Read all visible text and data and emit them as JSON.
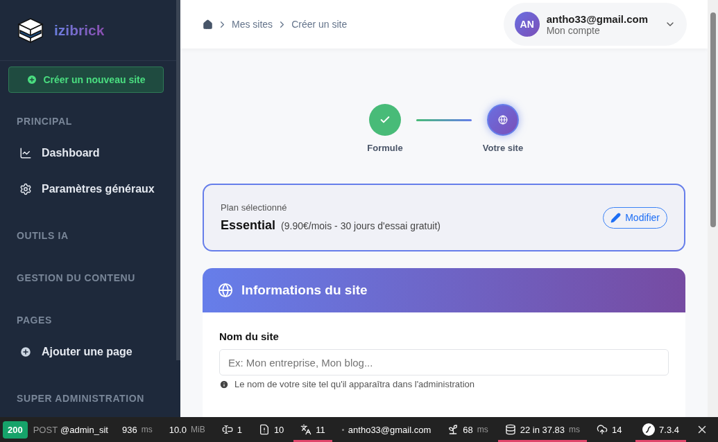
{
  "sidebar": {
    "brand": "izibrick",
    "create_button": "Créer un nouveau site",
    "sections": [
      {
        "title": "PRINCIPAL",
        "items": [
          {
            "label": "Dashboard",
            "kind": "chart"
          },
          {
            "label": "Paramètres généraux",
            "kind": "settings"
          }
        ]
      },
      {
        "title": "OUTILS IA"
      },
      {
        "title": "GESTION DU CONTENU"
      },
      {
        "title": "PAGES",
        "items": [
          {
            "label": "Ajouter une page",
            "kind": "add"
          }
        ]
      },
      {
        "title": "SUPER ADMINISTRATION"
      }
    ]
  },
  "breadcrumb": [
    "Mes sites",
    "Créer un site"
  ],
  "account": {
    "initials": "AN",
    "email": "antho33@gmail.com",
    "subtitle": "Mon compte"
  },
  "steps": [
    {
      "label": "Formule",
      "done": true
    },
    {
      "label": "Votre site",
      "done": false
    }
  ],
  "plan": {
    "caption": "Plan sélectionné",
    "name": "Essential",
    "details": "(9.90€/mois - 30 jours d'essai gratuit)",
    "button": "Modifier"
  },
  "site_info": {
    "title": "Informations du site",
    "field_label": "Nom du site",
    "placeholder": "Ex: Mon entreprise, Mon blog...",
    "help": "Le nom de votre site tel qu'il apparaîtra dans l'administration"
  },
  "debug_bar": {
    "status": "200",
    "method": "POST",
    "route": "@admin_sit",
    "items": [
      {
        "kind": "time",
        "value": "936",
        "unit": "ms",
        "alert": false
      },
      {
        "kind": "memory",
        "value": "10.0",
        "unit": "MiB",
        "alert": false
      },
      {
        "kind": "form",
        "value": "1",
        "alert": false
      },
      {
        "kind": "logs",
        "value": "10",
        "alert": false
      },
      {
        "kind": "translation",
        "value": "11",
        "alert": true
      },
      {
        "kind": "user",
        "value": "antho33@gmail.com",
        "alert": false
      },
      {
        "kind": "twig",
        "value": "68",
        "unit": "ms",
        "alert": false
      },
      {
        "kind": "db",
        "value": "22 in 37.83",
        "unit": "ms",
        "alert": true
      },
      {
        "kind": "http",
        "value": "14",
        "alert": false
      },
      {
        "kind": "symfony",
        "value": "7.3.4",
        "alert": true
      }
    ]
  }
}
